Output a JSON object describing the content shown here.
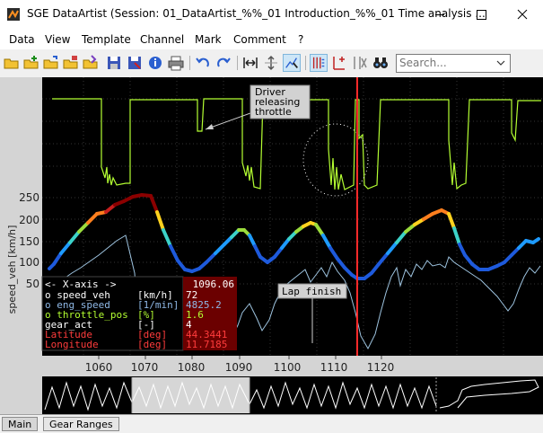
{
  "window": {
    "title": "SGE DataArtist (Session: 01_DataArtist_%%_01 Introduction_%%_01 Time analysis ..."
  },
  "menu": [
    "Data",
    "View",
    "Template",
    "Channel",
    "Mark",
    "Comment",
    "?"
  ],
  "toolbar": {
    "search_placeholder": "Search..."
  },
  "annotations": {
    "driver": [
      "Driver",
      "releasing",
      "throttle"
    ],
    "lap": "Lap finish"
  },
  "axis": {
    "ylabel": "speed_veh [km/h]",
    "yticks": [
      "250",
      "200",
      "150",
      "100",
      "50"
    ],
    "xticks": [
      "1060",
      "1070",
      "1080",
      "1090",
      "1100",
      "1110",
      "1120"
    ]
  },
  "legend": {
    "x_label": "<- X-axis ->",
    "x_value": "1096.06",
    "channels": [
      {
        "name": "o speed_veh",
        "unit": "[km/h]",
        "value": "72",
        "color": "#ffffff"
      },
      {
        "name": "o eng_speed",
        "unit": "[1/min]",
        "value": "4825.2",
        "color": "#8fb8e6"
      },
      {
        "name": "o throttle_pos",
        "unit": "[%]",
        "value": "1.6",
        "color": "#b4ff32"
      },
      {
        "name": "  gear_act",
        "unit": "[-]",
        "value": "4",
        "color": "#ffffff"
      },
      {
        "name": "  Latitude",
        "unit": "[deg]",
        "value": "44.3441",
        "color": "#ff3c3c"
      },
      {
        "name": "  Longitude",
        "unit": "[deg]",
        "value": "11.7185",
        "color": "#ff3c3c"
      }
    ]
  },
  "tabs": [
    "Main",
    "Gear Ranges"
  ],
  "colors": {
    "throttle": "#b4ff32",
    "eng_speed": "#9ec4e0",
    "cursor": "#ff2a2a",
    "speed_low": "#1e6cf0",
    "speed_high": "#8b0000"
  }
}
